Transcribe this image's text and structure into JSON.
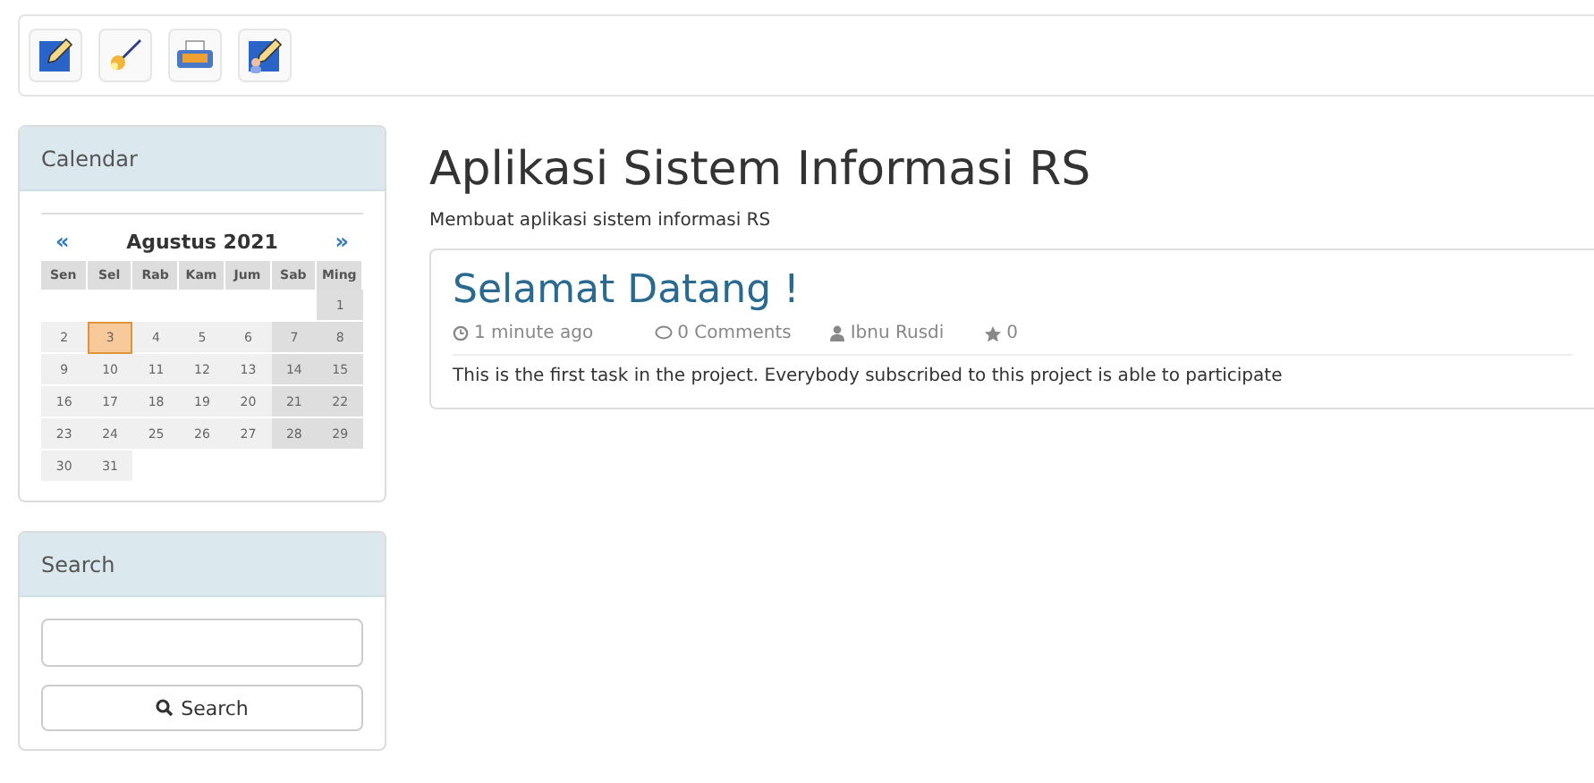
{
  "toolbar": {
    "buttons": [
      {
        "kind": "pen"
      },
      {
        "kind": "wand"
      },
      {
        "kind": "typewriter"
      },
      {
        "kind": "user-pen"
      }
    ]
  },
  "calendar": {
    "title": "Calendar",
    "prev": "«",
    "month": "Agustus 2021",
    "next": "»",
    "weekdays": [
      "Sen",
      "Sel",
      "Rab",
      "Kam",
      "Jum",
      "Sab",
      "Ming"
    ],
    "weeks": [
      {
        "days": [
          {
            "label": "1",
            "selected": false
          }
        ]
      },
      {
        "days": [
          {
            "label": "2",
            "selected": false
          },
          {
            "label": "3",
            "selected": true
          },
          {
            "label": "4",
            "selected": false
          },
          {
            "label": "5",
            "selected": false
          },
          {
            "label": "6",
            "selected": false
          },
          {
            "label": "7",
            "selected": false
          },
          {
            "label": "8",
            "selected": false
          }
        ]
      },
      {
        "days": [
          {
            "label": "9",
            "selected": false
          },
          {
            "label": "10",
            "selected": false
          },
          {
            "label": "11",
            "selected": false
          },
          {
            "label": "12",
            "selected": false
          },
          {
            "label": "13",
            "selected": false
          },
          {
            "label": "14",
            "selected": false
          },
          {
            "label": "15",
            "selected": false
          }
        ]
      },
      {
        "days": [
          {
            "label": "16",
            "selected": false
          },
          {
            "label": "17",
            "selected": false
          },
          {
            "label": "18",
            "selected": false
          },
          {
            "label": "19",
            "selected": false
          },
          {
            "label": "20",
            "selected": false
          },
          {
            "label": "21",
            "selected": false
          },
          {
            "label": "22",
            "selected": false
          }
        ]
      },
      {
        "days": [
          {
            "label": "23",
            "selected": false
          },
          {
            "label": "24",
            "selected": false
          },
          {
            "label": "25",
            "selected": false
          },
          {
            "label": "26",
            "selected": false
          },
          {
            "label": "27",
            "selected": false
          },
          {
            "label": "28",
            "selected": false
          },
          {
            "label": "29",
            "selected": false
          }
        ]
      },
      {
        "days": [
          {
            "label": "30",
            "selected": false
          },
          {
            "label": "31",
            "selected": false
          }
        ]
      }
    ]
  },
  "search": {
    "title": "Search",
    "button": "Search"
  },
  "page": {
    "title": "Aplikasi Sistem Informasi RS",
    "subtitle": "Membuat aplikasi sistem informasi RS"
  },
  "post": {
    "title": "Selamat Datang !",
    "time": "1 minute ago",
    "comments": "0 Comments",
    "author": "Ibnu Rusdi",
    "stars_count": "0",
    "body": "This is the first task in the project. Everybody subscribed to this project is able to participate"
  }
}
